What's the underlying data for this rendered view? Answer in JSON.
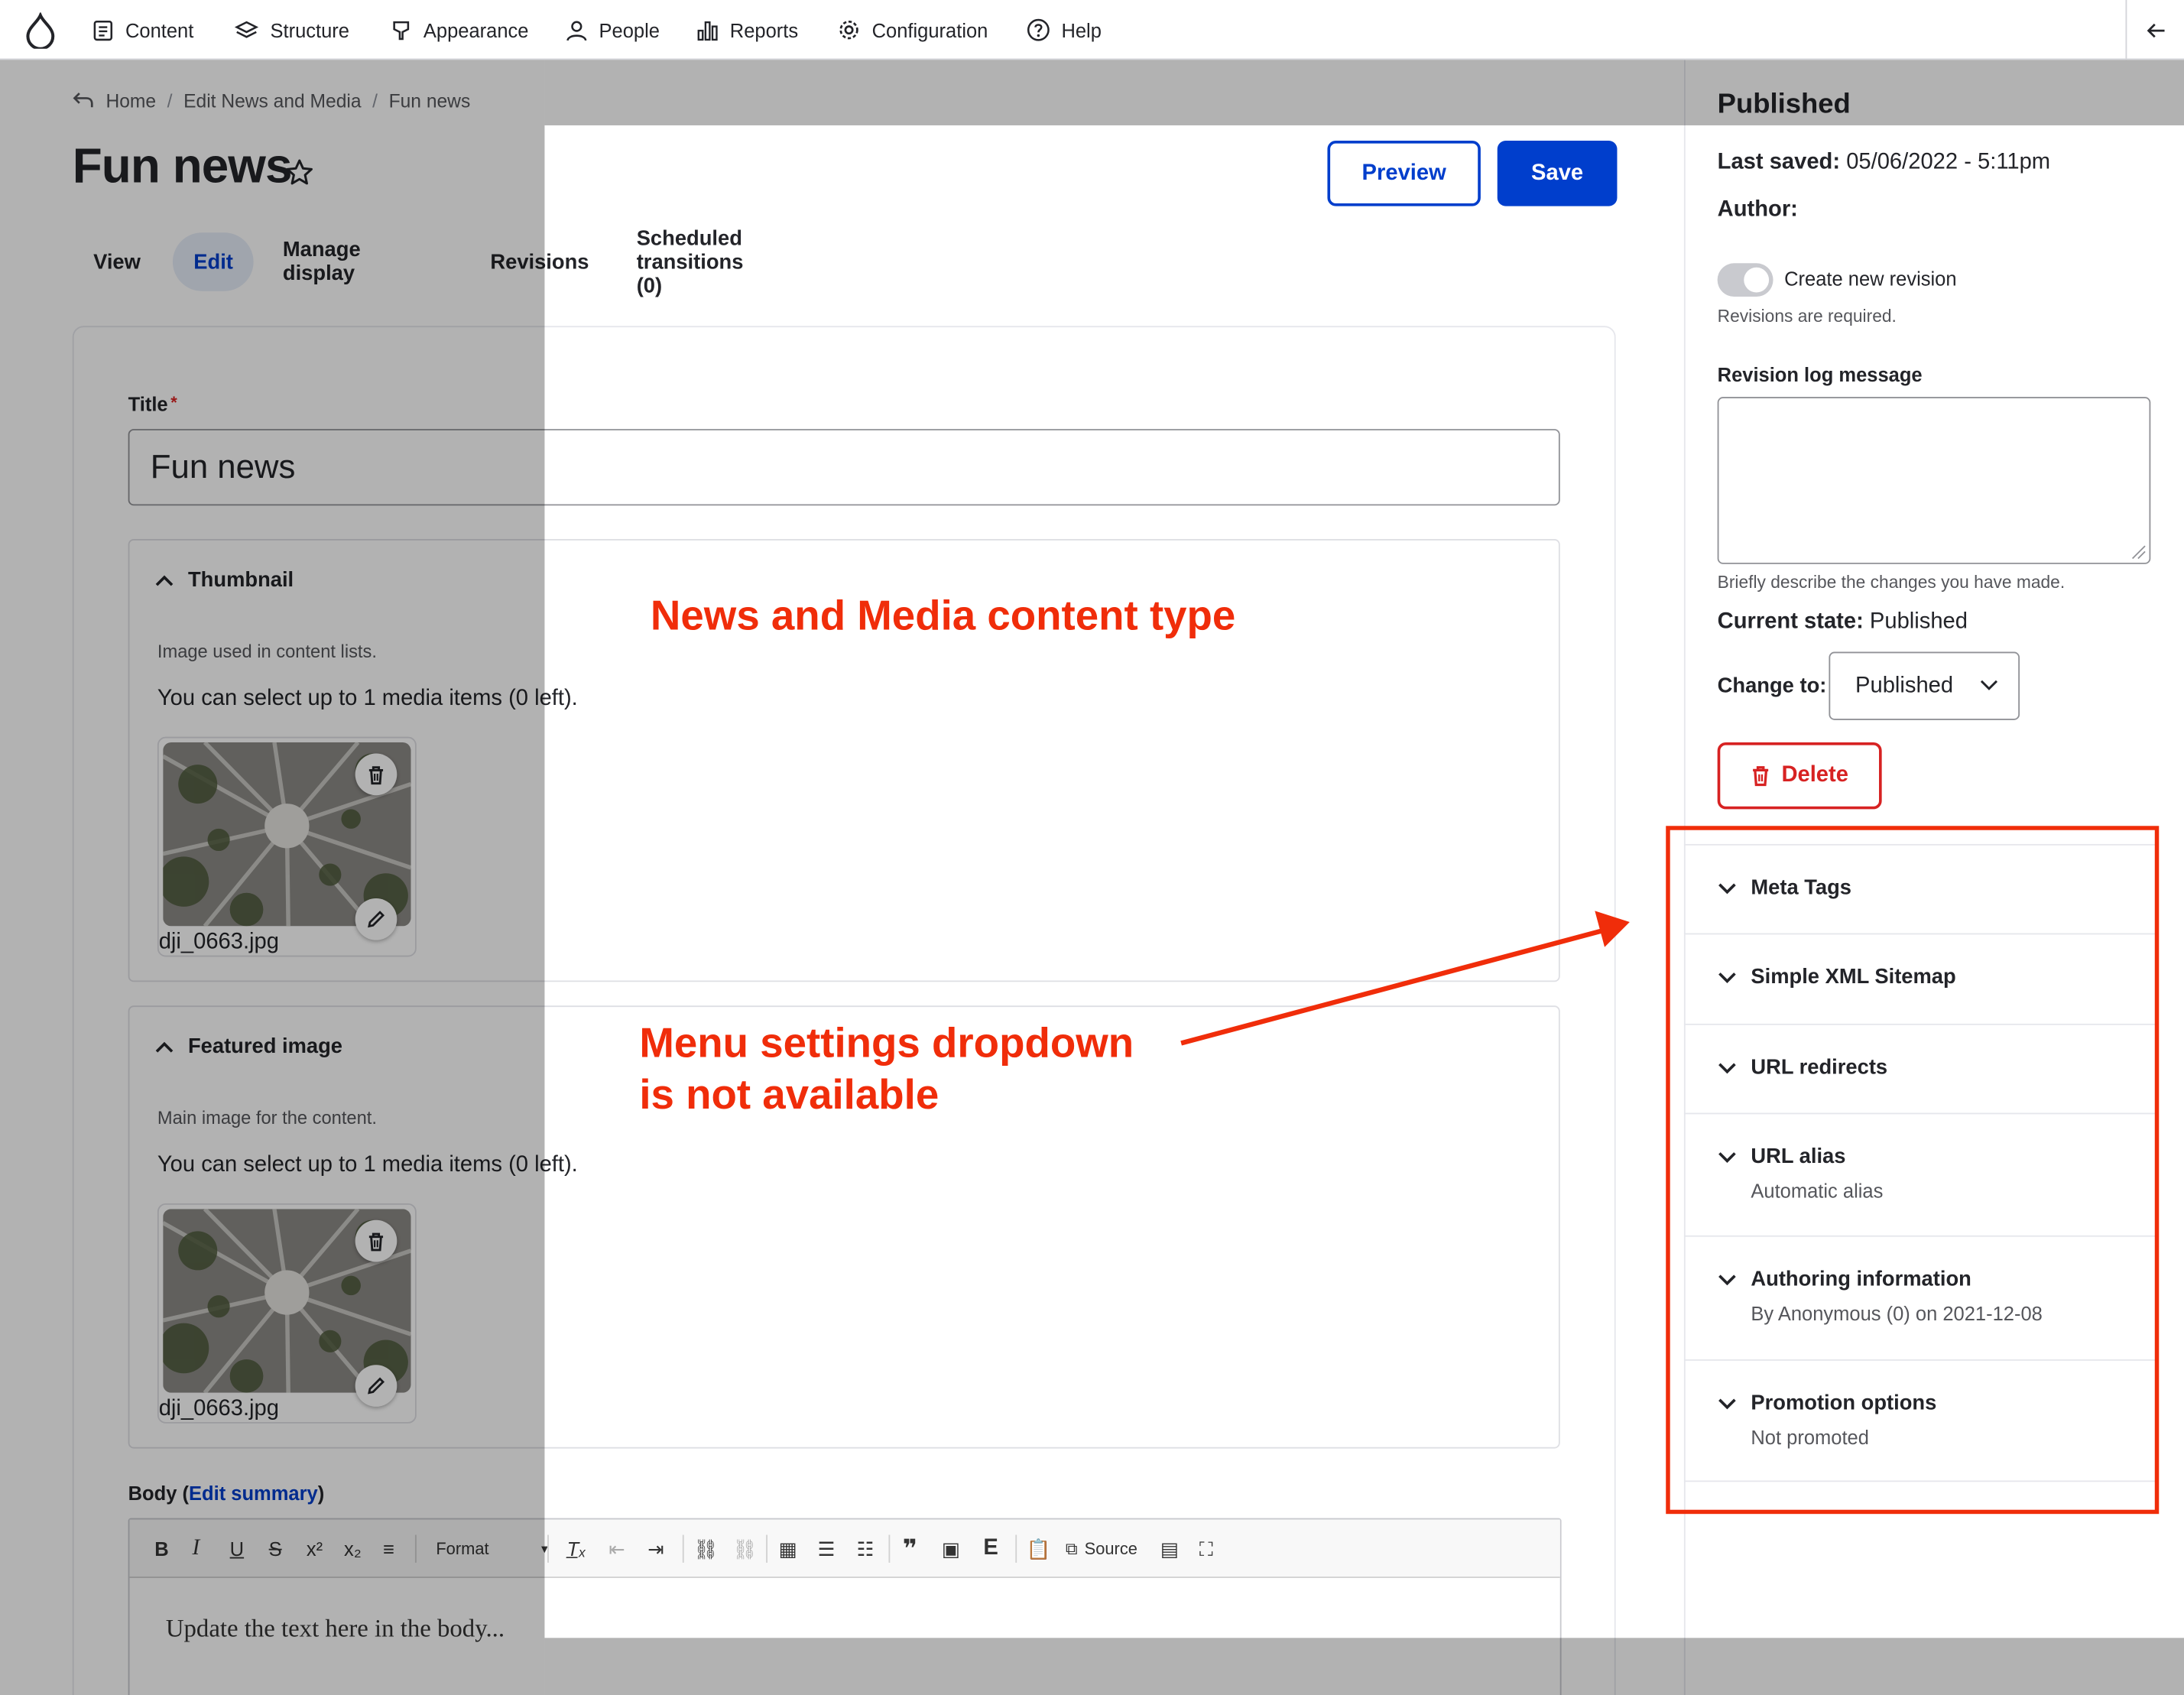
{
  "toolbar": {
    "items": [
      {
        "label": "Content",
        "icon": "content-icon"
      },
      {
        "label": "Structure",
        "icon": "structure-icon"
      },
      {
        "label": "Appearance",
        "icon": "appearance-icon"
      },
      {
        "label": "People",
        "icon": "people-icon"
      },
      {
        "label": "Reports",
        "icon": "reports-icon"
      },
      {
        "label": "Configuration",
        "icon": "gear-icon"
      },
      {
        "label": "Help",
        "icon": "help-icon"
      }
    ]
  },
  "breadcrumb": [
    "Home",
    "/",
    "Edit News and Media",
    "/",
    "Fun news"
  ],
  "page": {
    "title": "Fun news",
    "preview_label": "Preview",
    "save_label": "Save"
  },
  "tabs": [
    "View",
    "Edit",
    "Manage display",
    "Revisions",
    "Scheduled transitions (0)"
  ],
  "form": {
    "title_label": "Title",
    "required_mark": "*",
    "title_value": "Fun news",
    "thumbnail": {
      "heading": "Thumbnail",
      "description": "Image used in content lists.",
      "limit_text": "You can select up to 1 media items (0 left).",
      "file_name": "dji_0663.jpg"
    },
    "featured": {
      "heading": "Featured image",
      "description": "Main image for the content.",
      "limit_text": "You can select up to 1 media items (0 left).",
      "file_name": "dji_0663.jpg"
    },
    "body": {
      "label_prefix": "Body (",
      "edit_summary": "Edit summary",
      "label_suffix": ")",
      "format_label": "Format",
      "source_label": "Source",
      "text": "Update the text here in the body..."
    }
  },
  "sidebar": {
    "status": "Published",
    "last_saved_label": "Last saved:",
    "last_saved_value": "05/06/2022 - 5:11pm",
    "author_label": "Author:",
    "revision_toggle_label": "Create new revision",
    "revision_required": "Revisions are required.",
    "revision_log_label": "Revision log message",
    "revision_log_help": "Briefly describe the changes you have made.",
    "current_state_label": "Current state:",
    "current_state_value": "Published",
    "change_to_label": "Change to:",
    "change_to_value": "Published",
    "delete_label": "Delete",
    "accordions": [
      {
        "title": "Meta Tags",
        "summary": ""
      },
      {
        "title": "Simple XML Sitemap",
        "summary": ""
      },
      {
        "title": "URL redirects",
        "summary": ""
      },
      {
        "title": "URL alias",
        "summary": "Automatic alias"
      },
      {
        "title": "Authoring information",
        "summary": "By Anonymous (0) on 2021-12-08"
      },
      {
        "title": "Promotion options",
        "summary": "Not promoted"
      }
    ]
  },
  "annotations": {
    "content_type_note": "News and Media content type",
    "menu_note_line1": "Menu settings dropdown",
    "menu_note_line2": "is not available",
    "color": "#f02d0a"
  },
  "colors": {
    "primary": "#003ecc",
    "danger": "#d72222",
    "annotation": "#f02d0a"
  }
}
